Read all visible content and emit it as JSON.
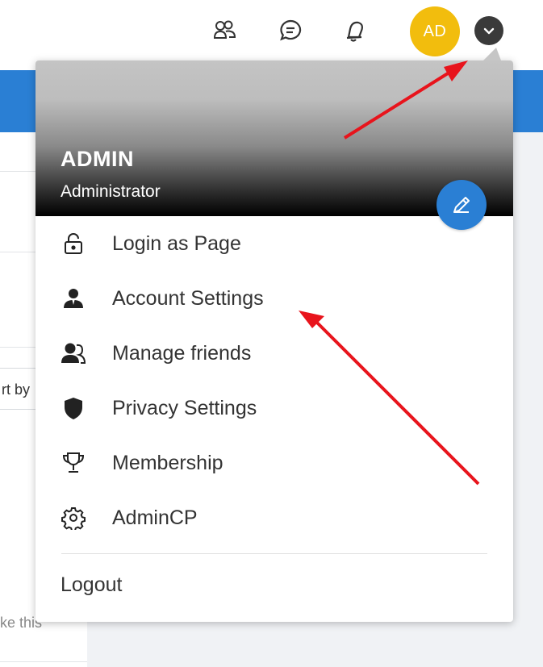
{
  "header": {
    "icons": [
      "friends-icon",
      "chat-icon",
      "notification-bell-icon"
    ],
    "avatar_initials": "AD",
    "avatar_color": "#f2bd0d",
    "dropdown_icon": "chevron-down-icon"
  },
  "background": {
    "sort_fragment": "rt by",
    "bottom_fragment": "ke this",
    "accent_color": "#2a7fd4"
  },
  "menu": {
    "username": "ADMIN",
    "role": "Administrator",
    "edit_icon": "pencil-icon",
    "items": [
      {
        "label": "Login as Page",
        "icon": "unlock-icon"
      },
      {
        "label": "Account Settings",
        "icon": "user-icon"
      },
      {
        "label": "Manage friends",
        "icon": "friends-icon"
      },
      {
        "label": "Privacy Settings",
        "icon": "shield-icon"
      },
      {
        "label": "Membership",
        "icon": "trophy-icon"
      },
      {
        "label": "AdminCP",
        "icon": "gear-icon"
      }
    ],
    "logout_label": "Logout"
  },
  "annotation_color": "#e8141c"
}
